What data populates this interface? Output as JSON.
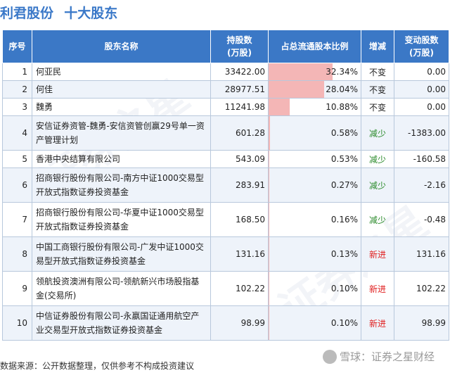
{
  "title": {
    "company": "利君股份",
    "section": "十大股东"
  },
  "headers": [
    "序号",
    "股东名称",
    "持股数\n(万股)",
    "占总流通股本比例",
    "增减",
    "变动股数\n(万股)"
  ],
  "rows": [
    {
      "no": "1",
      "name": "何亚民",
      "shares": "33422.00",
      "ratio": "32.34%",
      "ratio_value": 32.34,
      "change": "不变",
      "change_type": "keep",
      "delta": "0.00"
    },
    {
      "no": "2",
      "name": "何佳",
      "shares": "28977.51",
      "ratio": "28.04%",
      "ratio_value": 28.04,
      "change": "不变",
      "change_type": "keep",
      "delta": "0.00"
    },
    {
      "no": "3",
      "name": "魏勇",
      "shares": "11241.98",
      "ratio": "10.88%",
      "ratio_value": 10.88,
      "change": "不变",
      "change_type": "keep",
      "delta": "0.00"
    },
    {
      "no": "4",
      "name": "安信证券资管-魏勇-安信资管创赢29号单一资产管理计划",
      "shares": "601.28",
      "ratio": "0.58%",
      "ratio_value": 0.58,
      "change": "减少",
      "change_type": "down",
      "delta": "-1383.00"
    },
    {
      "no": "5",
      "name": "香港中央结算有限公司",
      "shares": "543.09",
      "ratio": "0.53%",
      "ratio_value": 0.53,
      "change": "减少",
      "change_type": "down",
      "delta": "-160.58"
    },
    {
      "no": "6",
      "name": "招商银行股份有限公司-南方中证1000交易型开放式指数证券投资基金",
      "shares": "283.91",
      "ratio": "0.27%",
      "ratio_value": 0.27,
      "change": "减少",
      "change_type": "down",
      "delta": "-2.16"
    },
    {
      "no": "7",
      "name": "招商银行股份有限公司-华夏中证1000交易型开放式指数证券投资基金",
      "shares": "168.50",
      "ratio": "0.16%",
      "ratio_value": 0.16,
      "change": "减少",
      "change_type": "down",
      "delta": "-0.48"
    },
    {
      "no": "8",
      "name": "中国工商银行股份有限公司-广发中证1000交易型开放式指数证券投资基金",
      "shares": "131.16",
      "ratio": "0.13%",
      "ratio_value": 0.13,
      "change": "新进",
      "change_type": "new",
      "delta": "131.16"
    },
    {
      "no": "9",
      "name": "领航投资澳洲有限公司-领航新兴市场股指基金(交易所)",
      "shares": "102.22",
      "ratio": "0.10%",
      "ratio_value": 0.1,
      "change": "新进",
      "change_type": "new",
      "delta": "102.22"
    },
    {
      "no": "10",
      "name": "中信证券股份有限公司-永嬴国证通用航空产业交易型开放式指数证券投资基金",
      "shares": "98.99",
      "ratio": "0.10%",
      "ratio_value": 0.1,
      "change": "新进",
      "change_type": "new",
      "delta": "98.99"
    }
  ],
  "footer": "数据来源：公开数据整理，仅供参考不构成投资建议",
  "logo_text": "雪球：证券之星财经",
  "watermark": "证券之星",
  "colors": {
    "header_bg": "#3b78c6",
    "title": "#3a78c8",
    "bar": "#f4b6b6",
    "down": "#2a8a2a",
    "new": "#e02020"
  }
}
